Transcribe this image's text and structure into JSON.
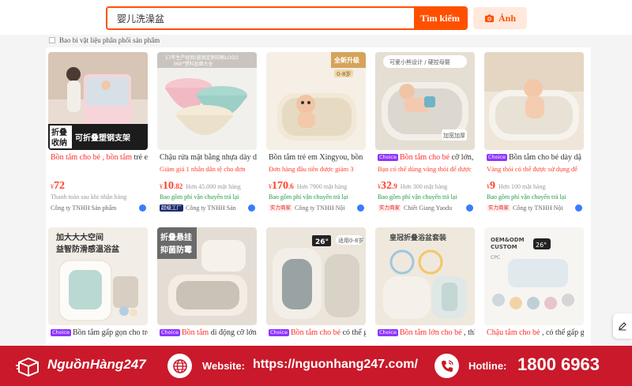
{
  "search": {
    "query": "婴儿洗澡盆",
    "button_label": "Tìm kiếm",
    "image_button_label": "Ảnh"
  },
  "filter": {
    "label": "Bao bì vật liệu phân phối sản phẩm"
  },
  "products": [
    {
      "choice": "",
      "title_highlight": "Bồn tắm cho bé , bồn tắm",
      "title_rest": " trẻ e",
      "promo": "",
      "currency": "¥",
      "price_int": "72",
      "price_dec": "",
      "sold": "",
      "shipping": "Thanh toán sau khi nhận hàng",
      "shop_tag": "",
      "shop": "Công ty TNHH Sản phẩm",
      "image_text": [
        "折叠",
        "收纳",
        "可折叠塑钢支架"
      ]
    },
    {
      "choice": "",
      "title_highlight": "",
      "title_rest": "Chậu rửa mặt bằng nhựa dày d",
      "promo": "Giảm giá 1 nhân dân tệ cho đơn",
      "currency": "¥",
      "price_int": "10",
      "price_dec": ".82",
      "sold": "Hơn 45.000 mặt hàng",
      "shipping": "Bao gồm phí vận chuyển trả lại",
      "shop_tag": "超级工厂",
      "shop": "Công ty TNHH Sản",
      "image_text": [
        "17年生产经验/直销定制印刷LOGO",
        "360°塑料盆面大全"
      ]
    },
    {
      "choice": "",
      "title_highlight": "",
      "title_rest": "Bồn tắm trẻ em Xingyou, bồn",
      "promo": "Đơn hàng đầu tiên được giảm 3",
      "currency": "¥",
      "price_int": "170",
      "price_dec": ".6",
      "sold": "Hơn 7900 mặt hàng",
      "shipping": "Bao gồm phí vận chuyển trả lại",
      "shop_tag": "实力商家",
      "shop": "Công ty TNHH Nội",
      "image_text": [
        "全新升级",
        "0-8岁"
      ]
    },
    {
      "choice": "Choice",
      "title_highlight": "Bồn tắm cho bé",
      "title_rest": " cỡ lớn,",
      "promo": "Bạn có thể dùng vàng thỏi để được",
      "currency": "¥",
      "price_int": "32",
      "price_dec": ".9",
      "sold": "Hơn 300 mặt hàng",
      "shipping": "Bao gồm phí vận chuyển trả lại",
      "shop_tag": "实力商家",
      "shop": "Chiết Giang Yaodu",
      "image_text": [
        "可爱小熊设计 / 硬控母婴",
        "加宽加厚"
      ]
    },
    {
      "choice": "Choice",
      "title_highlight": "",
      "title_rest": "Bồn tắm cho bé dày dặ",
      "promo": "Vàng thỏi có thể được sử dụng để",
      "currency": "¥",
      "price_int": "9",
      "price_dec": "",
      "sold": "Hơn 100 mặt hàng",
      "shipping": "Bao gồm phí vận chuyển trả lại",
      "shop_tag": "实力商家",
      "shop": "Công ty TNHH Nội",
      "image_text": []
    },
    {
      "choice": "Choice",
      "title_highlight": "",
      "title_rest": "Bồn tắm gấp gọn cho trẻ",
      "image_text": [
        "加大大大空间",
        "益智防滑感温浴盆"
      ]
    },
    {
      "choice": "Choice",
      "title_highlight": "Bồn tắm",
      "title_rest": " di động cỡ lớn,",
      "image_text": [
        "折叠悬挂",
        "抑菌防霉"
      ]
    },
    {
      "choice": "Choice",
      "title_highlight": "Bồn tắm cho bé",
      "title_rest": " có thể g",
      "image_text": [
        "26°",
        "适用0-8岁"
      ]
    },
    {
      "choice": "Choice",
      "title_highlight": "Bồn tắm lớn cho bé",
      "title_rest": " , thì",
      "image_text": [
        "皇冠折叠浴盆套装"
      ]
    },
    {
      "choice": "",
      "title_highlight": "Chậu tắm cho bé",
      "title_rest": " , có thể gấp g",
      "image_text": [
        "OEM&ODM",
        "CUSTOM",
        "CPC",
        "26°"
      ]
    }
  ],
  "banner": {
    "brand": "NguồnHàng247",
    "website_label": "Website:",
    "website_url": "https://nguonhang247.com/",
    "hotline_label": "Hotline:",
    "hotline_number": "1800 6963"
  },
  "colors": {
    "accent": "#ff5000",
    "price": "#ff3f2a",
    "shipping": "#1f9b45",
    "choice": "#8f35ff",
    "banner": "#c9192a"
  },
  "icons": [
    "camera-icon",
    "logo-box-icon",
    "globe-icon",
    "phone-icon",
    "edit-icon"
  ]
}
